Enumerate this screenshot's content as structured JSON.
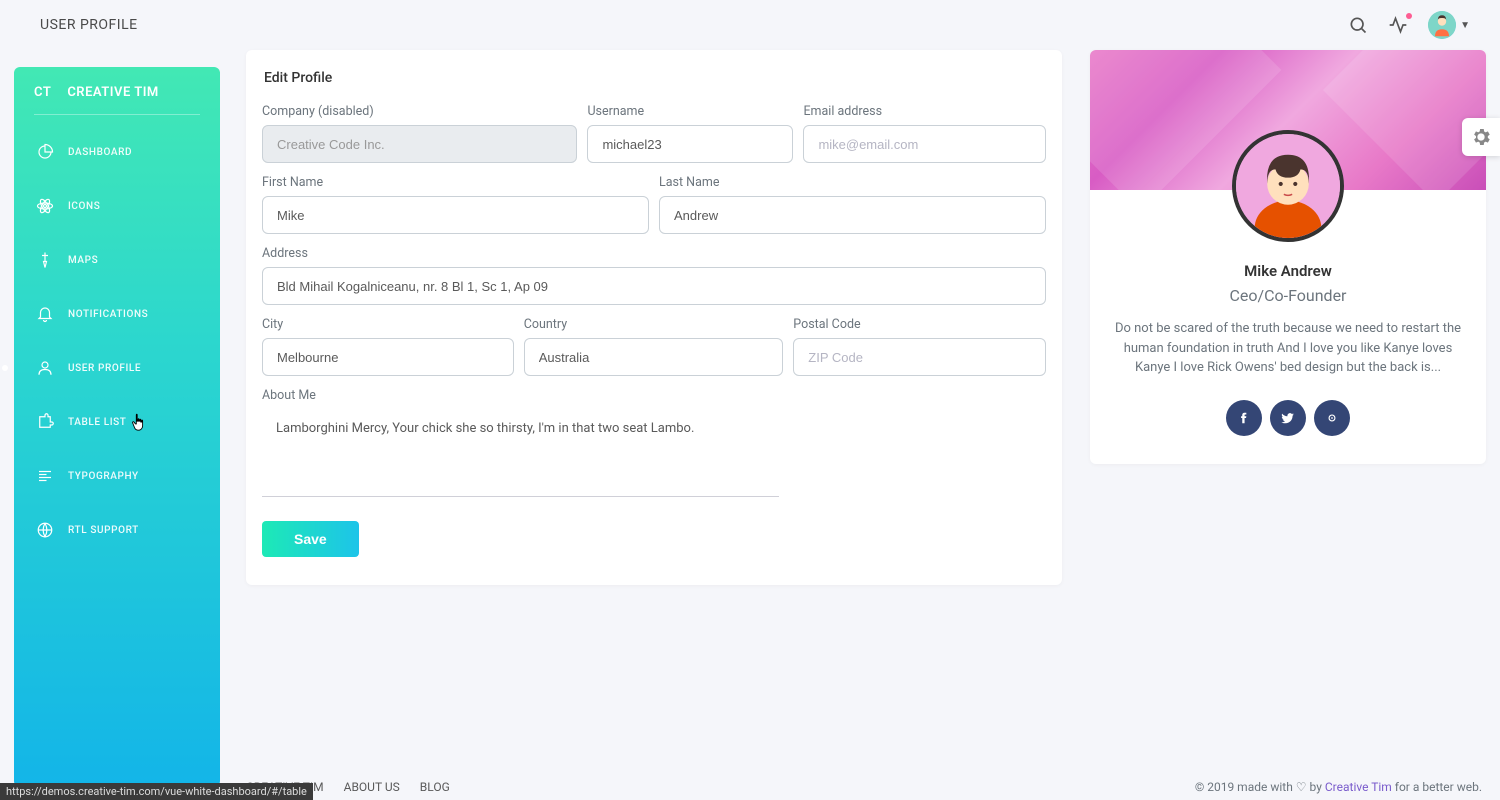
{
  "topbar": {
    "title": "USER PROFILE"
  },
  "sidebar": {
    "brand_short": "CT",
    "brand_full": "CREATIVE TIM",
    "items": [
      {
        "label": "DASHBOARD",
        "icon": "pie"
      },
      {
        "label": "ICONS",
        "icon": "atom"
      },
      {
        "label": "MAPS",
        "icon": "pin"
      },
      {
        "label": "NOTIFICATIONS",
        "icon": "bell"
      },
      {
        "label": "USER PROFILE",
        "icon": "user",
        "active": true
      },
      {
        "label": "TABLE LIST",
        "icon": "puzzle"
      },
      {
        "label": "TYPOGRAPHY",
        "icon": "align"
      },
      {
        "label": "RTL SUPPORT",
        "icon": "globe"
      }
    ]
  },
  "form": {
    "title": "Edit Profile",
    "company_label": "Company (disabled)",
    "company_value": "Creative Code Inc.",
    "username_label": "Username",
    "username_value": "michael23",
    "email_label": "Email address",
    "email_placeholder": "mike@email.com",
    "firstname_label": "First Name",
    "firstname_value": "Mike",
    "lastname_label": "Last Name",
    "lastname_value": "Andrew",
    "address_label": "Address",
    "address_value": "Bld Mihail Kogalniceanu, nr. 8 Bl 1, Sc 1, Ap 09",
    "city_label": "City",
    "city_value": "Melbourne",
    "country_label": "Country",
    "country_value": "Australia",
    "postal_label": "Postal Code",
    "postal_placeholder": "ZIP Code",
    "about_label": "About Me",
    "about_value": "Lamborghini Mercy, Your chick she so thirsty, I'm in that two seat Lambo.",
    "save_label": "Save"
  },
  "profile": {
    "name": "Mike Andrew",
    "title": "Ceo/Co-Founder",
    "desc": "Do not be scared of the truth because we need to restart the human foundation in truth And I love you like Kanye loves Kanye I love Rick Owens' bed design but the back is..."
  },
  "footer": {
    "links": [
      "CREATIVE TIM",
      "ABOUT US",
      "BLOG"
    ],
    "copyright_prefix": "© 2019 made with ",
    "copyright_mid": " by ",
    "copyright_link": "Creative Tim",
    "copyright_suffix": " for a better web."
  },
  "status_url": "https://demos.creative-tim.com/vue-white-dashboard/#/table"
}
